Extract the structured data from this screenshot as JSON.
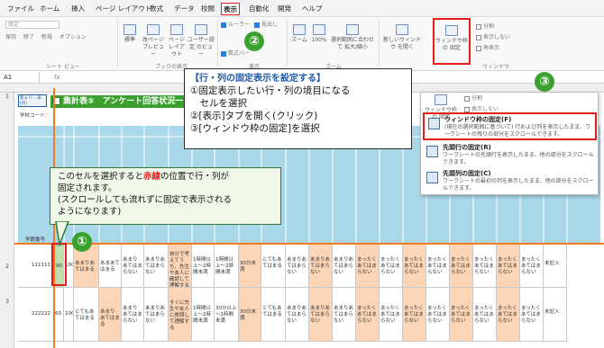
{
  "ribbon": {
    "tabs": [
      "ファイル",
      "ホーム",
      "挿入",
      "ページ レイアウト",
      "数式",
      "データ",
      "校閲",
      "表示",
      "自動化",
      "開発",
      "ヘルプ"
    ],
    "sheet_view": {
      "default": "既定",
      "keep": "保持",
      "exit": "終了",
      "new": "新規",
      "options": "オプション",
      "group": "シート ビュー"
    },
    "book_view": {
      "normal": "標準",
      "page_break": "改ページ プレビュー",
      "page_layout": "ページ レイアウト",
      "custom": "ユーザー設定 のビュー",
      "group": "ブックの表示"
    },
    "show": {
      "ruler": "ルーラー",
      "formula_bar": "数式バー",
      "gridlines": "目盛線",
      "headings": "見出し",
      "group": "表示"
    },
    "zoom": {
      "zoom": "ズーム",
      "hundred": "100%",
      "to_selection": "選択範囲に合わせて 拡大/縮小",
      "group": "ズーム"
    },
    "window": {
      "new_window": "新しいウィンドウ を開く",
      "freeze": "ウィンドウ枠の 固定",
      "split": "分割",
      "hide": "表示しない",
      "unhide": "再表示",
      "group": "ウィンドウ"
    }
  },
  "formula_bar": {
    "name_box": "A1",
    "fx": "fx"
  },
  "sheet": {
    "title": "集計表⑤　アンケート回答状況一",
    "logo": "新ヵリ… 表(月)",
    "school_code": "学校コード：",
    "row_numbers": [
      "1",
      "2",
      "3"
    ],
    "student_number": "学籍番号",
    "rows": [
      {
        "id": "111111",
        "col2": "90",
        "col3": "100",
        "cells": [
          "あまりあてはまる",
          "あまあてはまる",
          "あまりあてはまらない",
          "あまりあてはまらない",
          "自分で考えてうち、先生や友人に確認して理解する",
          "1時間以上～2時間未満",
          "1時間以上～2時間未満",
          "30分未満",
          "とてもあてはまる",
          "あまりあてはまらない",
          "あまりあてはまらない",
          "あまりあてはまらない",
          "まったくあてはまらない",
          "まったくあてはまらない",
          "まったくあてはまらない",
          "まったくあてはまらない",
          "まったくあてはまらない",
          "まったくあてはまらない",
          "まったくあてはまらない",
          "まったくあてはまらない",
          "未記入"
        ]
      },
      {
        "id": "222222",
        "col2": "60",
        "col3": "100",
        "cells": [
          "とてもあてはまる",
          "あまりあてはまる",
          "あまりあてはまらない",
          "あまりあてはまらない",
          "すぐに先生や友人に質問して理解する",
          "1時間以上～2時間未満",
          "30分以上～1時間未満",
          "30分未満",
          "とてもあてはまる",
          "あまりあてはまらない",
          "あまりあてはまらない",
          "あまりあてはまらない",
          "まったくあてはまらない",
          "まったくあてはまらない",
          "まったくあてはまらない",
          "まったくあてはまらない",
          "まったくあてはまらない",
          "まったくあてはまらない",
          "まったくあてはまらない",
          "まったくあてはまらない",
          "未記入"
        ]
      }
    ]
  },
  "callout_main": {
    "title": "【行・列の固定表示を設定する】",
    "line1": "①固定表示したい行・列の境目になる",
    "line2": "　セルを選択",
    "line3": "②[表示]タブを開く(クリック)",
    "line4": "③[ウィンドウ枠の固定]を選択"
  },
  "callout_green": {
    "line1_pre": "このセルを選択すると",
    "line1_red": "赤線",
    "line1_post": "の位置で行・列が",
    "line2": "固定されます。",
    "line3": "(スクロールしても流れずに固定で表示される",
    "line4": "ようになります)"
  },
  "badges": {
    "one": "①",
    "two": "②",
    "three": "③"
  },
  "menu": {
    "header_label": "ウィンドウ枠の 固定",
    "split": "分割",
    "hide": "表示しない",
    "items": [
      {
        "title": "ウィンドウ枠の固定(F)",
        "desc": "(現在の選択範囲に基づいて) 行および列を表示したまま、ワークシートの残りの部分をスクロールできます。"
      },
      {
        "title": "先頭行の固定(R)",
        "desc": "ワークシートの先頭行を表示したまま、他の部分をスクロールできます。"
      },
      {
        "title": "先頭列の固定(C)",
        "desc": "ワークシートの最初の列を表示したまま、他の部分をスクロールできます。"
      }
    ]
  },
  "colors": {
    "accent_red": "#e31c1c",
    "badge_green": "#3aa12f",
    "title_blue": "#1f5aa8",
    "freeze_line": "#f47a20"
  }
}
